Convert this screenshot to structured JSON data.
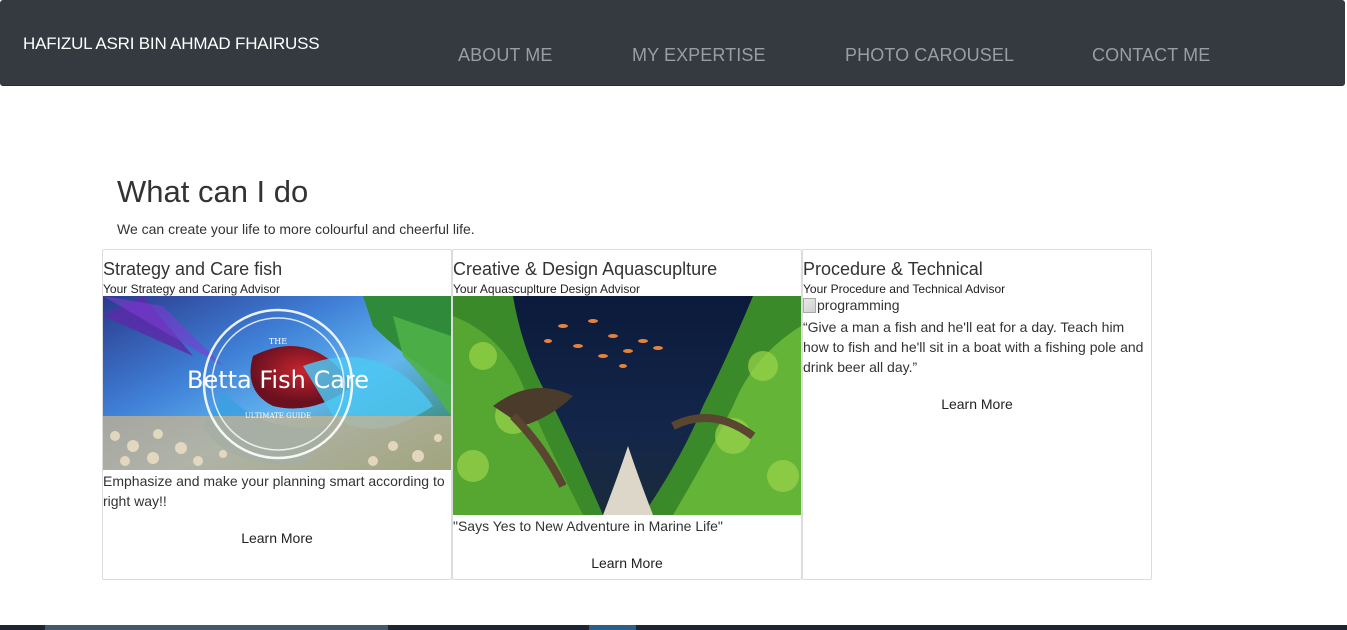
{
  "navbar": {
    "brand": "HAFIZUL ASRI BIN AHMAD FHAIRUSS",
    "links": [
      "ABOUT ME",
      "MY EXPERTISE",
      "PHOTO CAROUSEL",
      "CONTACT ME"
    ]
  },
  "section": {
    "title": "What can I do",
    "subtitle": "We can create your life to more colourful and cheerful life."
  },
  "cards": [
    {
      "title": "Strategy and Care fish",
      "subtitle": "Your Strategy and Caring Advisor",
      "image_text": "Betta Fish Care",
      "image_small_top": "THE",
      "image_small_bottom": "ULTIMATE GUIDE",
      "text": "Emphasize and make your planning smart according to right way!!",
      "link": "Learn More"
    },
    {
      "title": "Creative & Design Aquascuplture",
      "subtitle": "Your Aquascuplture Design Advisor",
      "text": "\"Says Yes to New Adventure in Marine Life\"",
      "link": "Learn More"
    },
    {
      "title": "Procedure & Technical",
      "subtitle": "Your Procedure and Technical Advisor",
      "image_alt": "programming",
      "text": "“Give a man a fish and he'll eat for a day. Teach him how to fish and he'll sit in a boat with a fishing pole and drink beer all day.”",
      "link": "Learn More"
    }
  ],
  "colors": {
    "navbar_bg": "#343a40",
    "nav_link": "#9a9da1",
    "card_border": "#dcdcdc"
  }
}
